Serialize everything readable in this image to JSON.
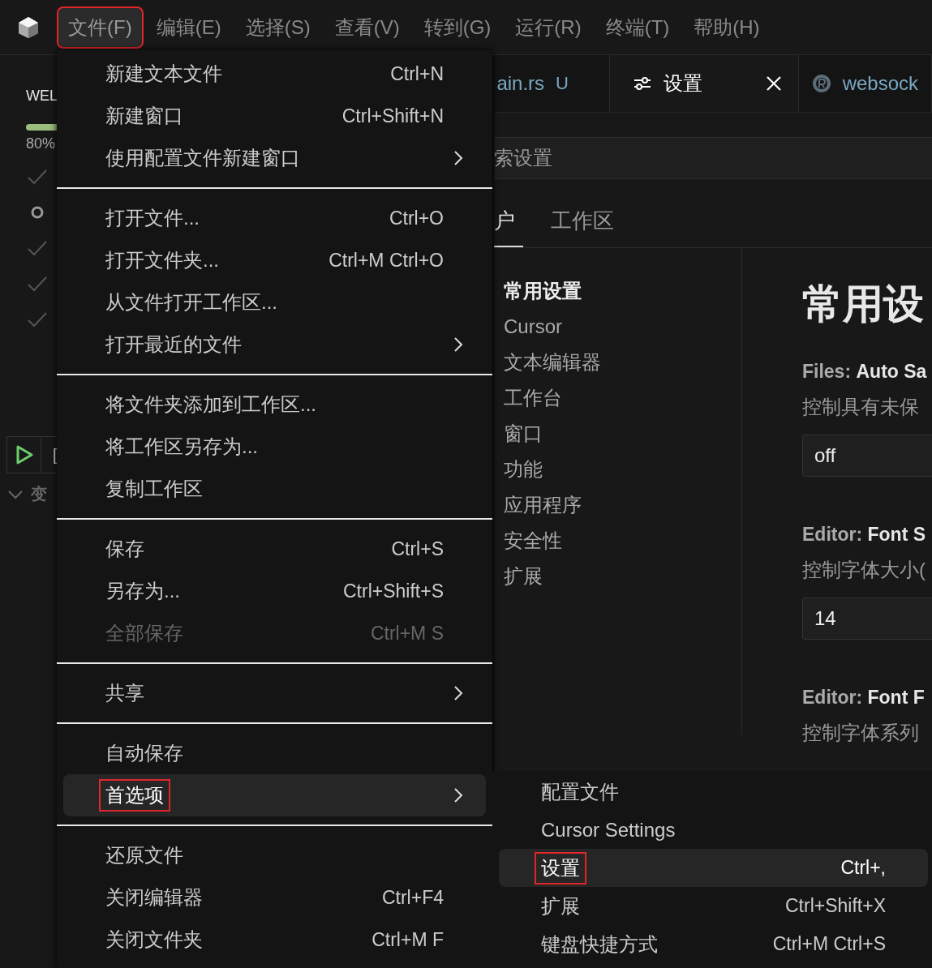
{
  "menubar": {
    "items": [
      {
        "label": "文件(F)",
        "selected": true,
        "annotated": true
      },
      {
        "label": "编辑(E)",
        "selected": false,
        "annotated": false
      },
      {
        "label": "选择(S)",
        "selected": false,
        "annotated": false
      },
      {
        "label": "查看(V)",
        "selected": false,
        "annotated": false
      },
      {
        "label": "转到(G)",
        "selected": false,
        "annotated": false
      },
      {
        "label": "运行(R)",
        "selected": false,
        "annotated": false
      },
      {
        "label": "终端(T)",
        "selected": false,
        "annotated": false
      },
      {
        "label": "帮助(H)",
        "selected": false,
        "annotated": false
      }
    ]
  },
  "sidebar": {
    "title": "WEL",
    "progress": {
      "level": 0.8,
      "reading": "80%"
    },
    "steps": [
      {
        "done": true
      },
      {
        "done": false
      },
      {
        "done": true
      },
      {
        "done": true
      },
      {
        "done": true
      }
    ],
    "run_label": "[",
    "section": "变"
  },
  "editor": {
    "tabs": [
      {
        "kind": "file",
        "label": "ain.rs",
        "badge": "U",
        "selected": false
      },
      {
        "kind": "settings",
        "label": "设置",
        "selected": true
      },
      {
        "kind": "rust",
        "label": "websock",
        "selected": false
      }
    ],
    "search": {
      "placeholder": "索设置"
    },
    "scope_tabs": [
      {
        "label": "户",
        "selected": true
      },
      {
        "label": "工作区",
        "selected": false
      }
    ],
    "nav": [
      {
        "label": "常用设置",
        "selected": true
      },
      {
        "label": "Cursor",
        "selected": false
      },
      {
        "label": "文本编辑器",
        "selected": false
      },
      {
        "label": "工作台",
        "selected": false
      },
      {
        "label": "窗口",
        "selected": false
      },
      {
        "label": "功能",
        "selected": false
      },
      {
        "label": "应用程序",
        "selected": false
      },
      {
        "label": "安全性",
        "selected": false
      },
      {
        "label": "扩展",
        "selected": false
      }
    ],
    "heading": "常用设",
    "settings": [
      {
        "category": "Files: ",
        "name": "Auto Sa",
        "description": "控制具有未保",
        "value": "off"
      },
      {
        "category": "Editor: ",
        "name": "Font S",
        "description": "控制字体大小(",
        "value": "14"
      },
      {
        "category": "Editor: ",
        "name": "Font F",
        "description": "控制字体系列"
      }
    ]
  },
  "file_menu": {
    "groups": [
      [
        {
          "label": "新建文本文件",
          "shortcut": "Ctrl+N",
          "submenu": false,
          "disabled": false,
          "selected": false,
          "annotated": false
        },
        {
          "label": "新建窗口",
          "shortcut": "Ctrl+Shift+N",
          "submenu": false,
          "disabled": false,
          "selected": false,
          "annotated": false
        },
        {
          "label": "使用配置文件新建窗口",
          "submenu": true,
          "disabled": false,
          "selected": false,
          "annotated": false
        }
      ],
      [
        {
          "label": "打开文件...",
          "shortcut": "Ctrl+O",
          "submenu": false,
          "disabled": false,
          "selected": false,
          "annotated": false
        },
        {
          "label": "打开文件夹...",
          "shortcut": "Ctrl+M Ctrl+O",
          "submenu": false,
          "disabled": false,
          "selected": false,
          "annotated": false
        },
        {
          "label": "从文件打开工作区...",
          "submenu": false,
          "disabled": false,
          "selected": false,
          "annotated": false
        },
        {
          "label": "打开最近的文件",
          "submenu": true,
          "disabled": false,
          "selected": false,
          "annotated": false
        }
      ],
      [
        {
          "label": "将文件夹添加到工作区...",
          "submenu": false,
          "disabled": false,
          "selected": false,
          "annotated": false
        },
        {
          "label": "将工作区另存为...",
          "submenu": false,
          "disabled": false,
          "selected": false,
          "annotated": false
        },
        {
          "label": "复制工作区",
          "submenu": false,
          "disabled": false,
          "selected": false,
          "annotated": false
        }
      ],
      [
        {
          "label": "保存",
          "shortcut": "Ctrl+S",
          "submenu": false,
          "disabled": false,
          "selected": false,
          "annotated": false
        },
        {
          "label": "另存为...",
          "shortcut": "Ctrl+Shift+S",
          "submenu": false,
          "disabled": false,
          "selected": false,
          "annotated": false
        },
        {
          "label": "全部保存",
          "shortcut": "Ctrl+M S",
          "submenu": false,
          "disabled": true,
          "selected": false,
          "annotated": false
        }
      ],
      [
        {
          "label": "共享",
          "submenu": true,
          "disabled": false,
          "selected": false,
          "annotated": false
        }
      ],
      [
        {
          "label": "自动保存",
          "submenu": false,
          "disabled": false,
          "selected": false,
          "annotated": false
        },
        {
          "label": "首选项",
          "submenu": true,
          "disabled": false,
          "selected": true,
          "annotated": true
        }
      ],
      [
        {
          "label": "还原文件",
          "submenu": false,
          "disabled": false,
          "selected": false,
          "annotated": false
        },
        {
          "label": "关闭编辑器",
          "shortcut": "Ctrl+F4",
          "submenu": false,
          "disabled": false,
          "selected": false,
          "annotated": false
        },
        {
          "label": "关闭文件夹",
          "shortcut": "Ctrl+M F",
          "submenu": false,
          "disabled": false,
          "selected": false,
          "annotated": false
        }
      ]
    ]
  },
  "preferences_submenu": {
    "items": [
      {
        "label": "配置文件",
        "submenu": false,
        "disabled": false,
        "selected": false,
        "annotated": false
      },
      {
        "label": "Cursor Settings",
        "submenu": false,
        "disabled": false,
        "selected": false,
        "annotated": false
      },
      {
        "label": "设置",
        "shortcut": "Ctrl+,",
        "submenu": false,
        "disabled": false,
        "selected": true,
        "annotated": true
      },
      {
        "label": "扩展",
        "shortcut": "Ctrl+Shift+X",
        "submenu": false,
        "disabled": false,
        "selected": false,
        "annotated": false
      },
      {
        "label": "键盘快捷方式",
        "shortcut": "Ctrl+M Ctrl+S",
        "submenu": false,
        "disabled": false,
        "selected": false,
        "annotated": false
      }
    ]
  }
}
